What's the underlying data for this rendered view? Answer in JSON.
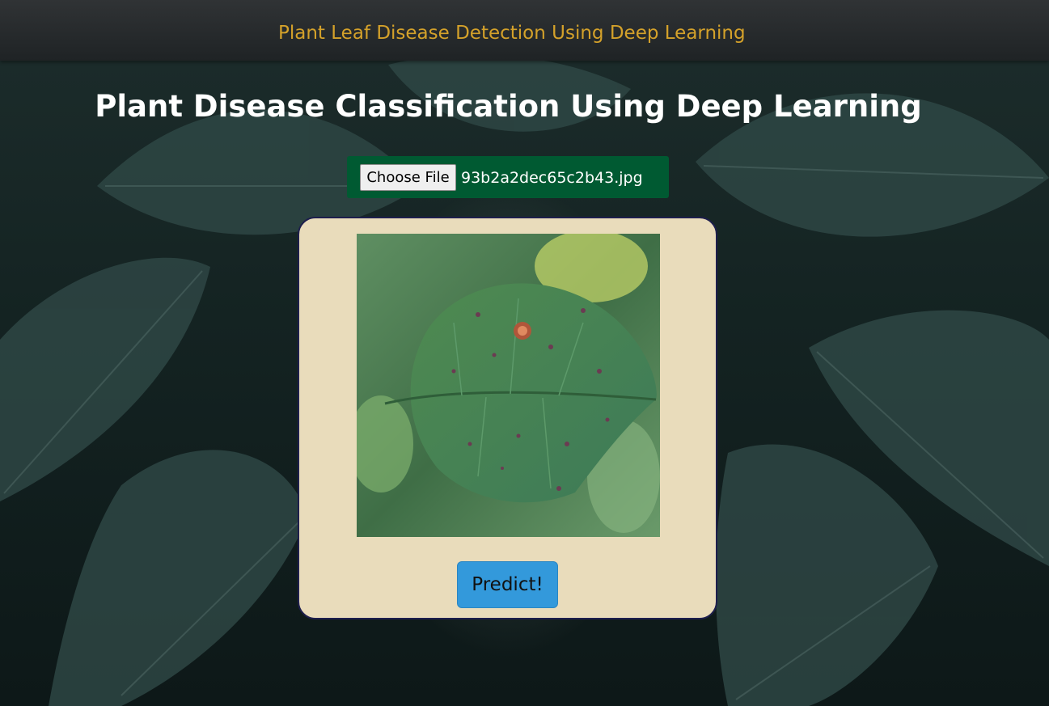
{
  "navbar": {
    "brand": "Plant Leaf Disease Detection Using Deep Learning"
  },
  "main": {
    "title": "Plant Disease Classification Using Deep Learning"
  },
  "upload": {
    "choose_label": "Choose File",
    "file_name": "93b2a2dec65c2b43.jpg"
  },
  "card": {
    "predict_label": "Predict!"
  },
  "colors": {
    "brand_text": "#d4a12a",
    "file_bar": "#005a32",
    "card_bg": "#e9dcbb",
    "card_border": "#1e1f4d",
    "predict_button": "#3399db"
  }
}
